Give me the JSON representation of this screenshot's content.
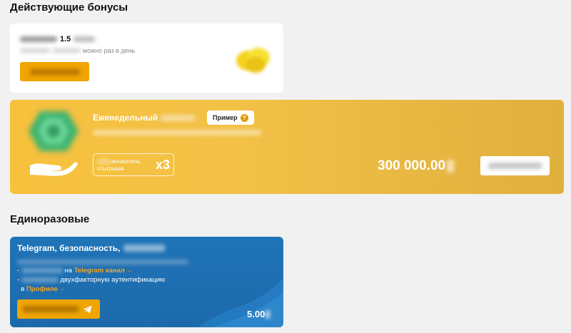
{
  "sections": {
    "active_title": "Действующие бонусы",
    "onetime_title": "Единоразовые"
  },
  "daily_card": {
    "title_prefix": "Получить",
    "title_value": "1.5",
    "description_suffix": "можно раз в день",
    "icon": "coins-icon"
  },
  "weekly_card": {
    "title": "Еженедельный",
    "example_badge": "Пример",
    "example_badge_icon": "?",
    "multiplier_label_suffix": "множитель",
    "multiplier_label_line2": "отыгрыша",
    "multiplier_value": "x3",
    "amount": "300 000.00",
    "icons": [
      "gem-icon",
      "hand-icon"
    ]
  },
  "telegram_card": {
    "title": "Telegram, безопасность,",
    "item1_prefix": "на",
    "item1_link": "Telegram канал",
    "item2_text": "двухфакторную аутентификацию",
    "item2_prefix": "в",
    "item2_link": "Профиле",
    "amount": "5.00",
    "button_icon": "telegram-send-icon"
  },
  "colors": {
    "accent_orange": "#f0a500",
    "weekly_gold": "#f2c146",
    "telegram_blue": "#1f74b7",
    "link_orange": "#f5a623"
  }
}
